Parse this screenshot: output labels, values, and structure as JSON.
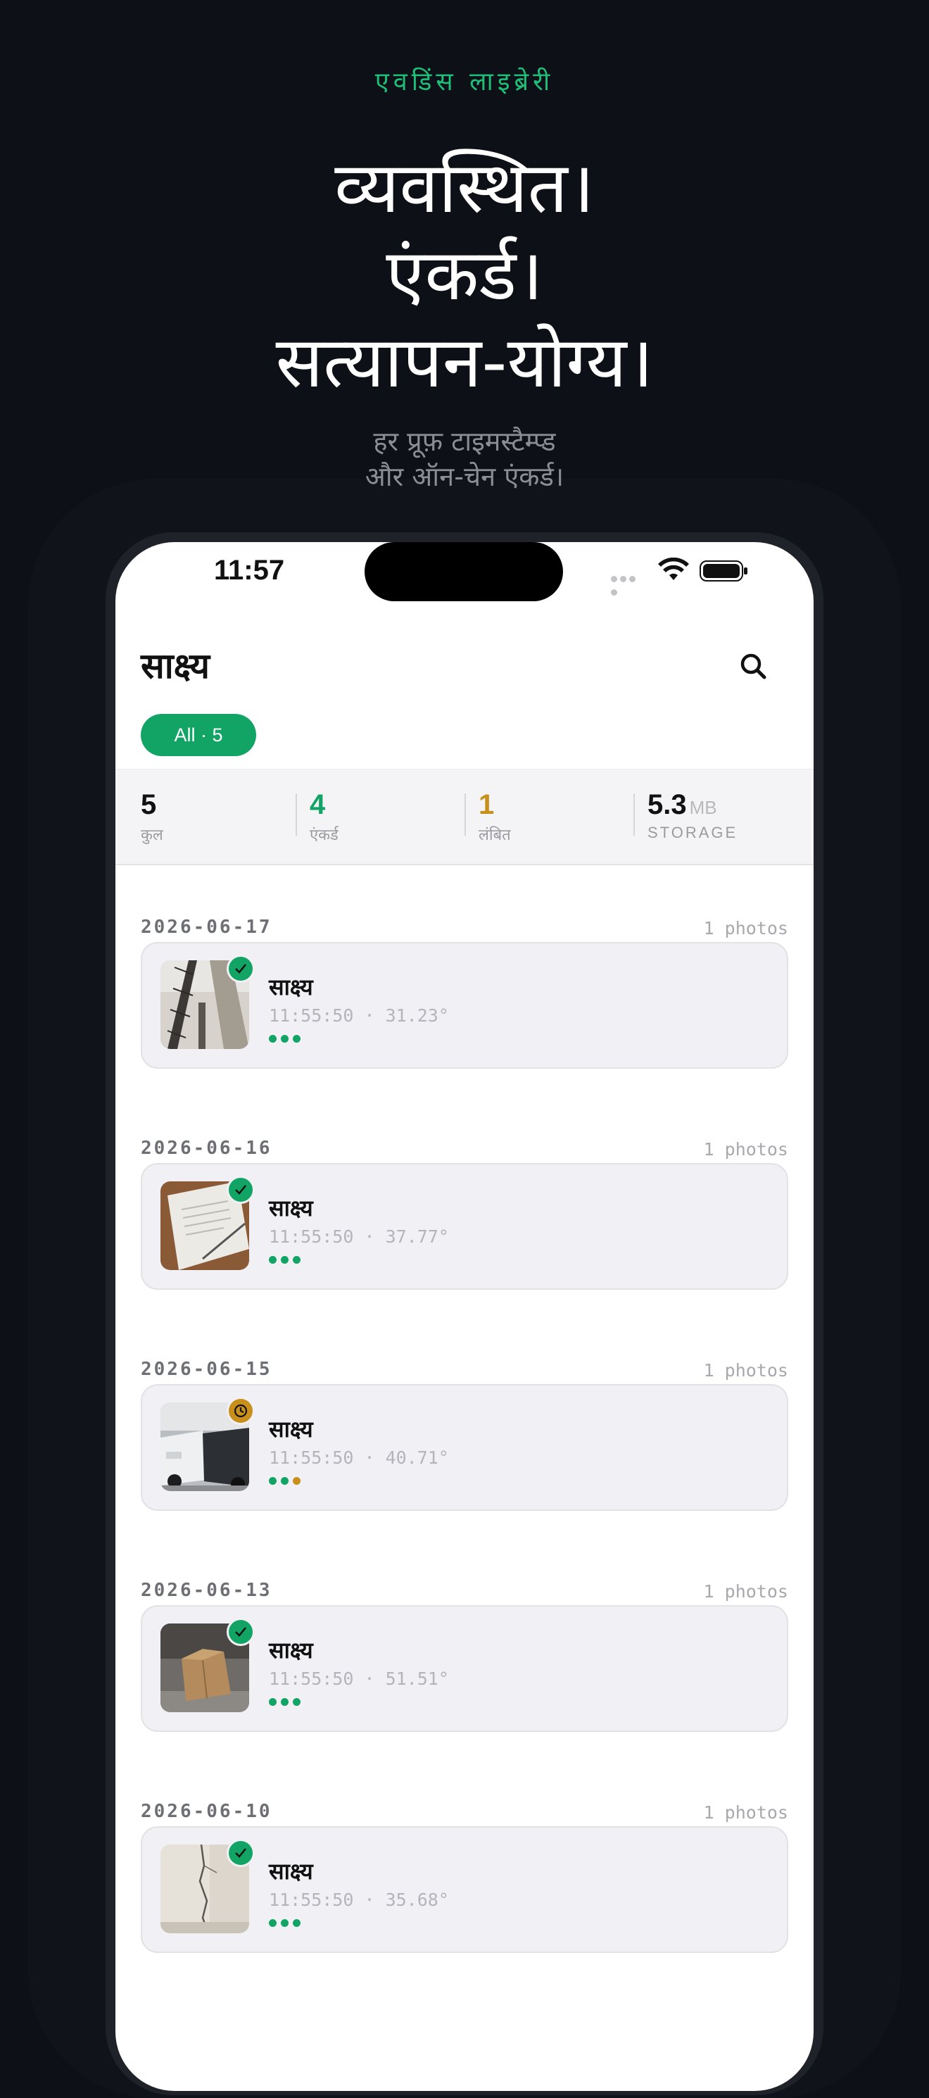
{
  "hero": {
    "eyebrow": "एवडिंस लाइब्रेरी",
    "headline": [
      "व्यवस्थित।",
      "एंकर्ड।",
      "सत्यापन-योग्य।"
    ],
    "subline": [
      "हर प्रूफ़ टाइमस्टैम्प्ड",
      "और ऑन-चेन एंकर्ड।"
    ]
  },
  "status_bar": {
    "time": "11:57"
  },
  "app": {
    "title": "साक्ष्य",
    "search_icon": "search-icon",
    "filter_chip": "All · 5"
  },
  "stats": {
    "total": {
      "value": "5",
      "label": "कुल"
    },
    "anchored": {
      "value": "4",
      "label": "एंकर्ड"
    },
    "pending": {
      "value": "1",
      "label": "लंबित"
    },
    "storage": {
      "value": "5.3",
      "unit": "MB",
      "label": "STORAGE"
    }
  },
  "colors": {
    "accent": "#12a465",
    "pending": "#c8901a",
    "dot_inactive": "#d0d0d4"
  },
  "groups": [
    {
      "date": "2026-06-17",
      "count": "1 photos",
      "item": {
        "title": "साक्ष्य",
        "meta": "11:55:50 · 31.23°",
        "status": "anchored",
        "status_icon": "check-icon",
        "thumb": "construction-crane",
        "dots": [
          "#12a465",
          "#12a465",
          "#12a465"
        ]
      }
    },
    {
      "date": "2026-06-16",
      "count": "1 photos",
      "item": {
        "title": "साक्ष्य",
        "meta": "11:55:50 · 37.77°",
        "status": "anchored",
        "status_icon": "check-icon",
        "thumb": "signed-document",
        "dots": [
          "#12a465",
          "#12a465",
          "#12a465"
        ]
      }
    },
    {
      "date": "2026-06-15",
      "count": "1 photos",
      "item": {
        "title": "साक्ष्य",
        "meta": "11:55:50 · 40.71°",
        "status": "pending",
        "status_icon": "clock-icon",
        "thumb": "car-collision",
        "dots": [
          "#12a465",
          "#12a465",
          "#c8901a"
        ]
      }
    },
    {
      "date": "2026-06-13",
      "count": "1 photos",
      "item": {
        "title": "साक्ष्य",
        "meta": "11:55:50 · 51.51°",
        "status": "anchored",
        "status_icon": "check-icon",
        "thumb": "damaged-box",
        "dots": [
          "#12a465",
          "#12a465",
          "#12a465"
        ]
      }
    },
    {
      "date": "2026-06-10",
      "count": "1 photos",
      "item": {
        "title": "साक्ष्य",
        "meta": "11:55:50 · 35.68°",
        "status": "anchored",
        "status_icon": "check-icon",
        "thumb": "cracked-wall",
        "dots": [
          "#12a465",
          "#12a465",
          "#12a465"
        ]
      }
    }
  ]
}
